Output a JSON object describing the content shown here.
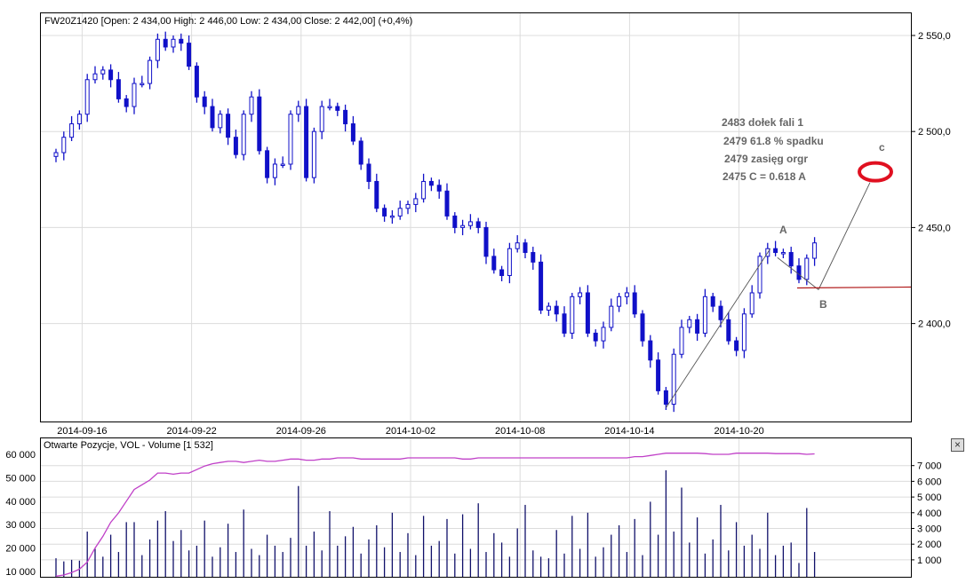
{
  "chart_data": [
    {
      "type": "candlestick",
      "title": "FW20Z1420 [Open: 2 434,00  High: 2 446,00  Low: 2 434,00  Close: 2 442,00] (+0,4%)",
      "ylim": [
        2349,
        2562
      ],
      "y_ticks": [
        {
          "v": 2550,
          "label": "2 550,0"
        },
        {
          "v": 2500,
          "label": "2 500,0"
        },
        {
          "v": 2450,
          "label": "2 450,0"
        },
        {
          "v": 2400,
          "label": "2 400,0"
        }
      ],
      "x_ticks": [
        {
          "i": 3,
          "label": "2014-09-16"
        },
        {
          "i": 17,
          "label": "2014-09-22"
        },
        {
          "i": 31,
          "label": "2014-09-26"
        },
        {
          "i": 45,
          "label": "2014-10-02"
        },
        {
          "i": 59,
          "label": "2014-10-08"
        },
        {
          "i": 73,
          "label": "2014-10-14"
        },
        {
          "i": 87,
          "label": "2014-10-20"
        }
      ],
      "start_open": 2487,
      "closes": [
        2489,
        2497,
        2504,
        2509,
        2527,
        2530,
        2532,
        2527,
        2517,
        2513,
        2525,
        2525,
        2537,
        2548,
        2544,
        2548,
        2546,
        2534,
        2518,
        2513,
        2502,
        2509,
        2497,
        2488,
        2509,
        2518,
        2490,
        2476,
        2483,
        2483,
        2509,
        2513,
        2476,
        2500,
        2513,
        2513,
        2511,
        2504,
        2495,
        2483,
        2474,
        2460,
        2456,
        2456,
        2460,
        2462,
        2465,
        2474,
        2472,
        2469,
        2456,
        2450,
        2451,
        2453,
        2450,
        2435,
        2428,
        2425,
        2439,
        2442,
        2437,
        2432,
        2407,
        2409,
        2405,
        2395,
        2414,
        2416,
        2395,
        2391,
        2398,
        2409,
        2414,
        2416,
        2405,
        2391,
        2381,
        2365,
        2358,
        2384,
        2398,
        2402,
        2395,
        2414,
        2409,
        2402,
        2391,
        2386,
        2405,
        2416,
        2435,
        2439,
        2437,
        2437,
        2430,
        2423,
        2434,
        2442
      ],
      "annotations": {
        "notes": [
          "2483 dołek fali 1",
          "2479   61.8 % spadku",
          "2479 zasięg orgr",
          "2475   C = 0.618 A"
        ],
        "wave_labels": {
          "a": "A",
          "b": "B",
          "c": "c"
        },
        "wave_points": {
          "start": 2358,
          "a": 2439,
          "b": 2419,
          "c_target": 2479
        },
        "support_level": 2419,
        "line_color": "#555555",
        "target_color": "#e01020",
        "support_color": "#b01818"
      },
      "candle_color": "#1010c8"
    },
    {
      "type": "bar+line",
      "title": "Otwarte Pozycje, VOL - Volume [1 532]",
      "volume_ylim": [
        0,
        8500
      ],
      "volume_ticks": [
        {
          "v": 1000,
          "label": "1 000"
        },
        {
          "v": 2000,
          "label": "2 000"
        },
        {
          "v": 3000,
          "label": "3 000"
        },
        {
          "v": 4000,
          "label": "4 000"
        },
        {
          "v": 5000,
          "label": "5 000"
        },
        {
          "v": 6000,
          "label": "6 000"
        },
        {
          "v": 7000,
          "label": "7 000"
        }
      ],
      "oi_ylim": [
        2000,
        63000
      ],
      "oi_ticks": [
        {
          "v": 10000,
          "label": "10 000"
        },
        {
          "v": 20000,
          "label": "20 000"
        },
        {
          "v": 30000,
          "label": "30 000"
        },
        {
          "v": 40000,
          "label": "40 000"
        },
        {
          "v": 50000,
          "label": "50 000"
        },
        {
          "v": 60000,
          "label": "60 000"
        }
      ],
      "volume": [
        1100,
        900,
        1000,
        950,
        2800,
        1700,
        1200,
        2600,
        1500,
        3400,
        3400,
        1300,
        2300,
        3500,
        4100,
        2200,
        2900,
        1600,
        1900,
        3500,
        1200,
        1800,
        3300,
        1500,
        4200,
        1700,
        1300,
        2600,
        1900,
        1500,
        2400,
        5700,
        1900,
        2800,
        1600,
        4100,
        1900,
        2500,
        3100,
        1400,
        2300,
        3200,
        1800,
        4000,
        1500,
        2700,
        1300,
        3800,
        1900,
        2200,
        3600,
        1400,
        3900,
        1700,
        4600,
        1500,
        2700,
        2100,
        1200,
        3000,
        4500,
        1600,
        1200,
        1100,
        2900,
        1400,
        3800,
        1700,
        4000,
        1200,
        1800,
        2600,
        3200,
        1500,
        3600,
        1300,
        4700,
        2600,
        6700,
        2800,
        5600,
        2100,
        3700,
        1400,
        2300,
        4500,
        1600,
        3400,
        1900,
        2600,
        1700,
        4000,
        1300,
        1900,
        2100,
        800,
        4300,
        1500
      ],
      "open_interest": [
        8000,
        8500,
        9500,
        11000,
        14000,
        20000,
        25000,
        31000,
        35000,
        40000,
        45000,
        47000,
        49000,
        52000,
        52000,
        51500,
        52000,
        52000,
        53500,
        55000,
        56000,
        56500,
        57000,
        57000,
        56500,
        57000,
        57500,
        57000,
        57000,
        57500,
        58000,
        58000,
        57500,
        57500,
        58000,
        58000,
        58500,
        58500,
        58500,
        58000,
        58000,
        58000,
        58000,
        58000,
        58000,
        58500,
        58500,
        58500,
        58500,
        58500,
        58500,
        58500,
        58000,
        58000,
        58500,
        58500,
        58500,
        58500,
        58500,
        58500,
        58500,
        58500,
        58500,
        58500,
        58500,
        58500,
        58500,
        58500,
        58500,
        58500,
        58500,
        58500,
        58500,
        58500,
        59000,
        59000,
        59500,
        60000,
        60500,
        60500,
        60500,
        60500,
        60500,
        60300,
        60000,
        60000,
        60000,
        60500,
        60500,
        60500,
        60500,
        60500,
        60300,
        60300,
        60300,
        60300,
        60000,
        60200
      ],
      "volume_color": "#10106a",
      "oi_color": "#c040c8"
    }
  ],
  "ui": {
    "close_icon": "×"
  }
}
